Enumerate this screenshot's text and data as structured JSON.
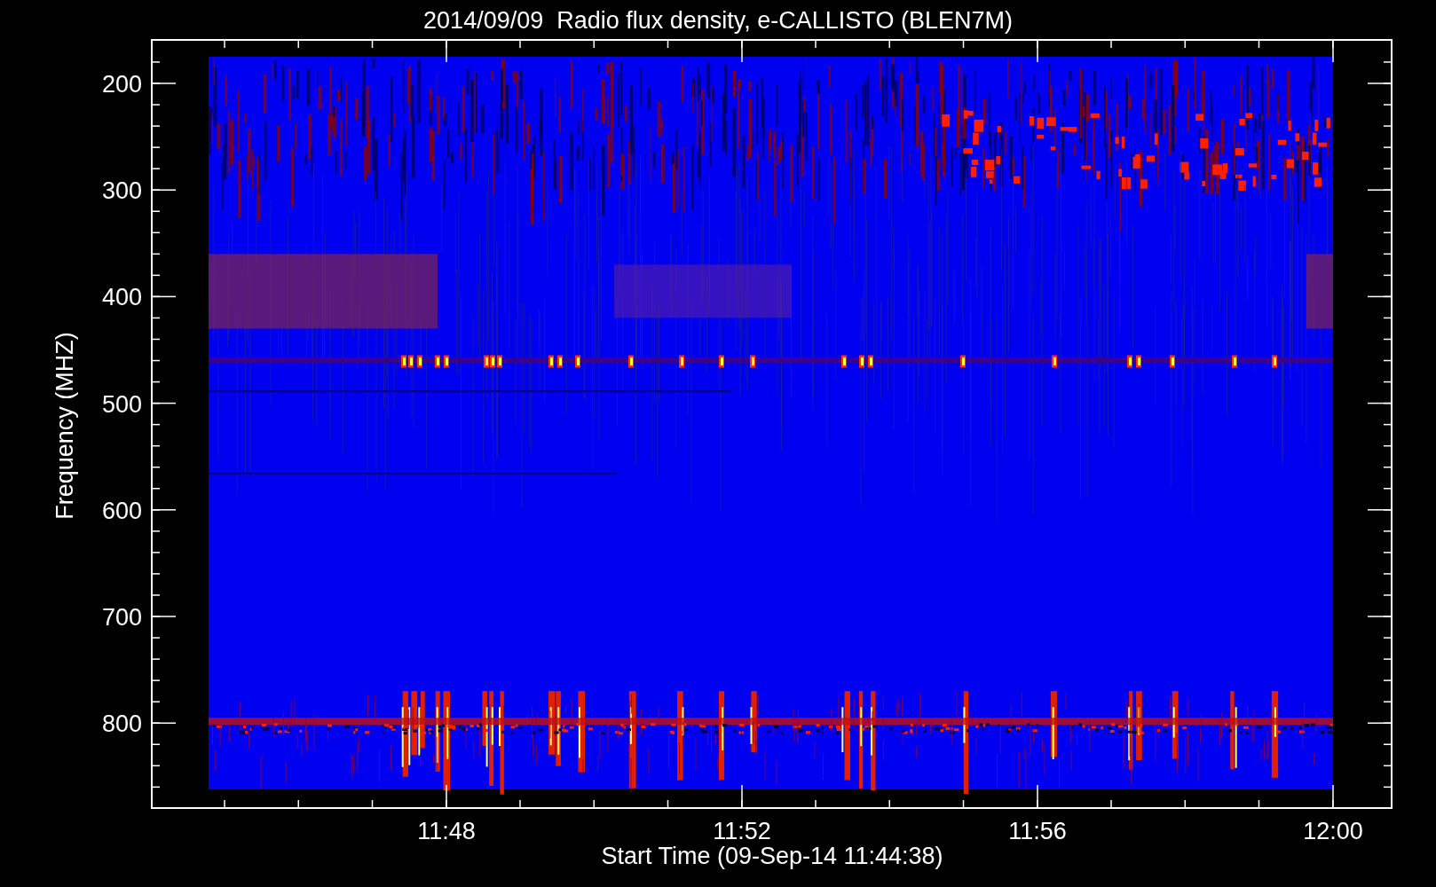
{
  "title": "2014/09/09  Radio flux density, e-CALLISTO (BLEN7M)",
  "y_axis": {
    "label": "Frequency (MHZ)",
    "ticks": [
      "200",
      "300",
      "400",
      "500",
      "600",
      "700",
      "800"
    ]
  },
  "x_axis": {
    "label": "Start Time (09-Sep-14 11:44:38)",
    "ticks": [
      "11:48",
      "11:52",
      "11:56",
      "12:00"
    ]
  }
}
